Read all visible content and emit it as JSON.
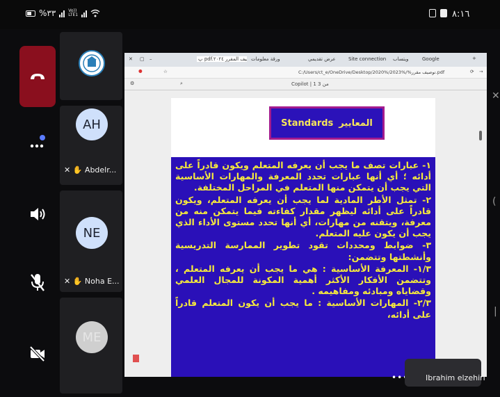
{
  "status_bar": {
    "battery_text": "%٣٣",
    "network_label": "Vo)) LTE1",
    "time": "٨:١٦"
  },
  "controls": {
    "leave_icon": "phone-hangup-icon",
    "more_icon": "more-dots-icon",
    "speaker_icon": "speaker-icon",
    "mic_icon": "mic-off-icon",
    "camera_icon": "camera-off-icon"
  },
  "participants": [
    {
      "initials": "",
      "name": "",
      "avatar_color": "#ffffff"
    },
    {
      "initials": "AH",
      "name": "Abdelr...",
      "avatar_color": "#cfe0fb"
    },
    {
      "initials": "NE",
      "name": "Noha E...",
      "avatar_color": "#cfe0fb"
    },
    {
      "initials": "ME",
      "name": "",
      "avatar_color": "#cfcfcf"
    }
  ],
  "browser": {
    "tabs": [
      "پ pdf.توصيف المقرر ٢٠٢٤",
      "ورقة معلومات",
      "عرض تقديمي",
      "Site connection",
      "ويتساب",
      "Google"
    ],
    "address": "C:/Users/ct_e/OneDrive/Desktop/2020%/2023%/%توصيف مقرر.pdf",
    "pdf_toolbar_text": "Copilot  | 1 من 3"
  },
  "slide": {
    "title_ar": "المعايير",
    "title_en": "Standards",
    "paragraphs": [
      "١- عبارات تصف ما يجب أن يعرفه المتعلم ويكون قادراً على أدائه ؛ أي أنها عبارات تحدد المعرفة والمهارات الأساسية التي يجب أن يتمكن منها المتعلم في المراحل المختلفة.",
      "٢- تمثل الأطر المادية لما يجب أن يعرفه المتعلم، ويكون قادراً على أدائه ليظهر مقدار كفاءته فيما يتمكن منه من معرفة، ويتقنه من مهارات، أي أنها تحدد مستوى الأداء الذي يجب أن يكون عليه المتعلم.",
      "٣- ضوابط ومحددات تقود تطوير الممارسة التدريسية وأنشطتها وتتضمن:",
      "١/٣- المعرفة الأساسية : هي ما يجب أن يعرفه المتعلم ، وتتضمن الأفكار الأكثر أهمية المكونة للمجال العلمي وقضاياه ومبادئه ومفاهيمه .",
      "٢/٣- المهارات الأساسية : ما يجب أن يكون المتعلم قادراً على أدائه،"
    ]
  },
  "presenter": {
    "name": "Ibrahim elzehiri"
  }
}
